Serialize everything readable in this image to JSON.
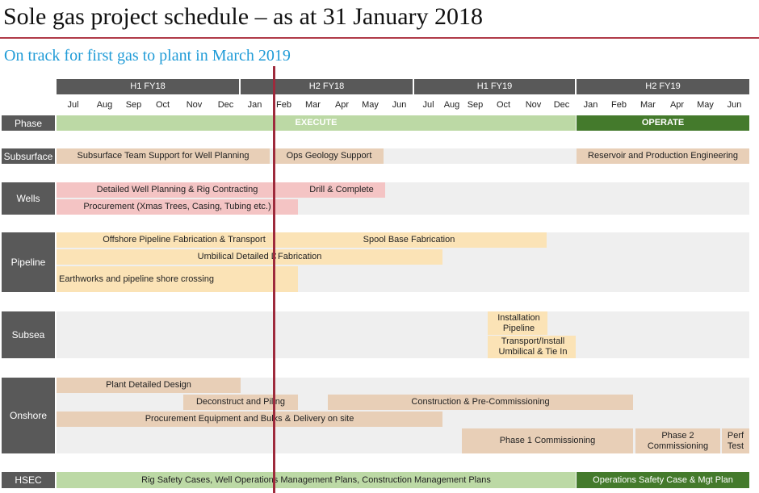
{
  "title": "Sole gas project schedule – as at 31 January 2018",
  "subtitle": "On track for first gas to plant in March 2019",
  "half_years": [
    "H1 FY18",
    "H2 FY18",
    "H1 FY19",
    "H2 FY19"
  ],
  "months": [
    "Jul",
    "Aug",
    "Sep",
    "Oct",
    "Nov",
    "Dec",
    "Jan",
    "Feb",
    "Mar",
    "Apr",
    "May",
    "Jun",
    "Jul",
    "Aug",
    "Sep",
    "Oct",
    "Nov",
    "Dec",
    "Jan",
    "Feb",
    "Mar",
    "Apr",
    "May",
    "Jun"
  ],
  "rows": {
    "phase": "Phase",
    "subsurface": "Subsurface",
    "wells": "Wells",
    "pipeline": "Pipeline",
    "subsea": "Subsea",
    "onshore": "Onshore",
    "hsec": "HSEC"
  },
  "bars": {
    "execute": "EXECUTE",
    "operate": "OPERATE",
    "subsurface_team": "Subsurface Team Support for Well Planning",
    "ops_geology": "Ops Geology Support",
    "reservoir": "Reservoir and Production Engineering",
    "well_planning": "Detailed Well Planning & Rig Contracting",
    "drill": "Drill & Complete",
    "procurement_wells": "Procurement (Xmas Trees, Casing, Tubing etc.)",
    "offshore_pipeline": "Offshore Pipeline Fabrication & Transport",
    "spool_base": "Spool Base Fabrication",
    "umbilical_design": "Umbilical Detailed Design",
    "umbilical_fab": "Fabrication",
    "earthworks": "Earthworks and pipeline shore crossing",
    "installation_pipeline": "Installation Pipeline",
    "transport_install": "Transport/Install Umbilical & Tie In",
    "plant_design": "Plant Detailed Design",
    "deconstruct": "Deconstruct and Piling",
    "construction": "Construction & Pre-Commissioning",
    "procurement_onshore": "Procurement Equipment and Bulks & Delivery on site",
    "phase1": "Phase 1 Commissioning",
    "phase2": "Phase 2 Commissioning",
    "perf_test": "Perf Test",
    "rig_safety": "Rig Safety Cases, Well Operations Management Plans, Construction Management Plans",
    "ops_safety": "Operations Safety Case & Mgt Plan"
  },
  "colors": {
    "header": "#595959",
    "today_line": "#9e2a3c",
    "execute": "#bcd9a5",
    "operate": "#447a2c",
    "subtitle": "#1f9bd7"
  }
}
